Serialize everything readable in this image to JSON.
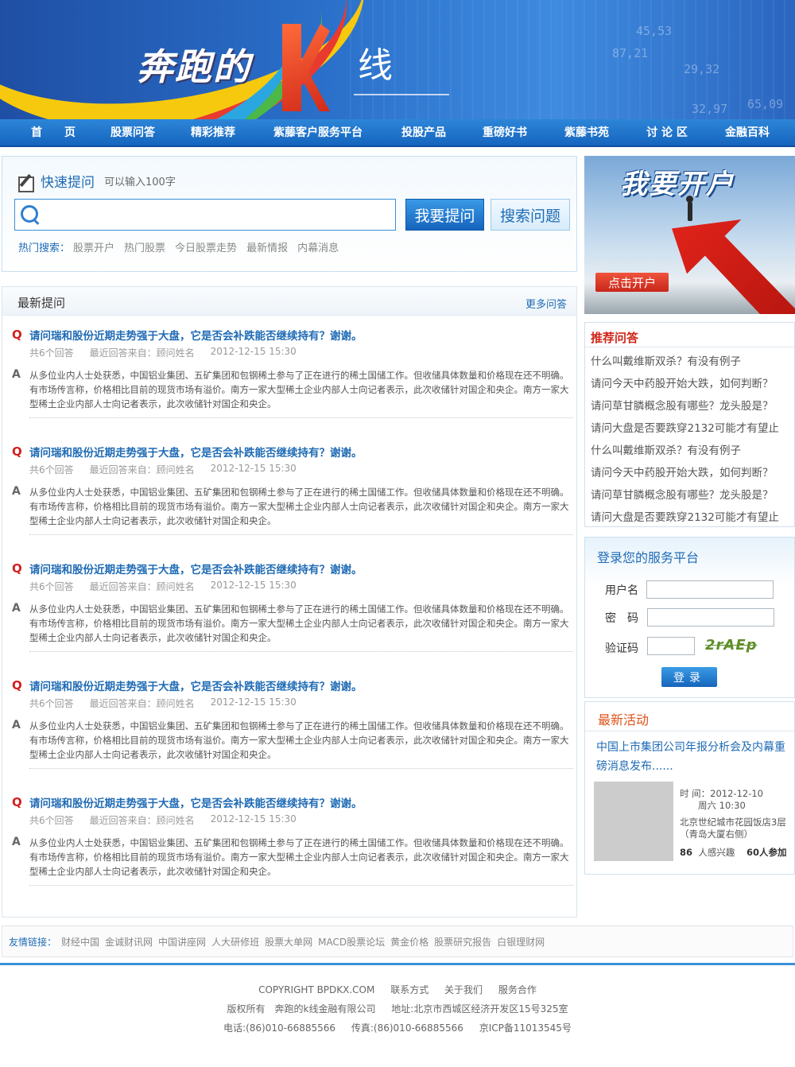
{
  "banner": {
    "title_part1": "奔跑的",
    "title_part2": "线",
    "ticker_numbers": [
      "45,53",
      "87,21",
      "29,32",
      "32,97",
      "65,09"
    ]
  },
  "nav": {
    "items": [
      "首　　页",
      "股票问答",
      "精彩推荐",
      "紫藤客户服务平台",
      "投股产品",
      "重磅好书",
      "紫藤书苑",
      "讨 论 区",
      "金融百科"
    ]
  },
  "ask": {
    "title": "快速提问",
    "hint": "可以输入100字",
    "search_placeholder": "",
    "ask_button": "我要提问",
    "search_button": "搜索问题",
    "hot_label": "热门搜索：",
    "hot_keywords": [
      "股票开户",
      "热门股票",
      "今日股票走势",
      "最新情报",
      "内幕消息"
    ]
  },
  "latest": {
    "title": "最新提问",
    "more": "更多问答",
    "items": [
      {
        "question": "请问瑞和股份近期走势强于大盘，它是否会补跌能否继续持有？谢谢。",
        "count": "共6个回答",
        "from": "最近回答来自：顾问姓名",
        "time": "2012-12-15 15:30",
        "answer": "从多位业内人士处获悉，中国铝业集团、五矿集团和包钢稀土参与了正在进行的稀土国储工作。但收储具体数量和价格现在还不明确。有市场传言称，价格相比目前的现货市场有溢价。南方一家大型稀土企业内部人士向记者表示，此次收储针对国企和央企。南方一家大型稀土企业内部人士向记者表示，此次收储针对国企和央企。"
      },
      {
        "question": "请问瑞和股份近期走势强于大盘，它是否会补跌能否继续持有？谢谢。",
        "count": "共6个回答",
        "from": "最近回答来自：顾问姓名",
        "time": "2012-12-15 15:30",
        "answer": "从多位业内人士处获悉，中国铝业集团、五矿集团和包钢稀土参与了正在进行的稀土国储工作。但收储具体数量和价格现在还不明确。有市场传言称，价格相比目前的现货市场有溢价。南方一家大型稀土企业内部人士向记者表示，此次收储针对国企和央企。南方一家大型稀土企业内部人士向记者表示，此次收储针对国企和央企。"
      },
      {
        "question": "请问瑞和股份近期走势强于大盘，它是否会补跌能否继续持有？谢谢。",
        "count": "共6个回答",
        "from": "最近回答来自：顾问姓名",
        "time": "2012-12-15 15:30",
        "answer": "从多位业内人士处获悉，中国铝业集团、五矿集团和包钢稀土参与了正在进行的稀土国储工作。但收储具体数量和价格现在还不明确。有市场传言称，价格相比目前的现货市场有溢价。南方一家大型稀土企业内部人士向记者表示，此次收储针对国企和央企。南方一家大型稀土企业内部人士向记者表示，此次收储针对国企和央企。"
      },
      {
        "question": "请问瑞和股份近期走势强于大盘，它是否会补跌能否继续持有？谢谢。",
        "count": "共6个回答",
        "from": "最近回答来自：顾问姓名",
        "time": "2012-12-15 15:30",
        "answer": "从多位业内人士处获悉，中国铝业集团、五矿集团和包钢稀土参与了正在进行的稀土国储工作。但收储具体数量和价格现在还不明确。有市场传言称，价格相比目前的现货市场有溢价。南方一家大型稀土企业内部人士向记者表示，此次收储针对国企和央企。南方一家大型稀土企业内部人士向记者表示，此次收储针对国企和央企。"
      },
      {
        "question": "请问瑞和股份近期走势强于大盘，它是否会补跌能否继续持有？谢谢。",
        "count": "共6个回答",
        "from": "最近回答来自：顾问姓名",
        "time": "2012-12-15 15:30",
        "answer": "从多位业内人士处获悉，中国铝业集团、五矿集团和包钢稀土参与了正在进行的稀土国储工作。但收储具体数量和价格现在还不明确。有市场传言称，价格相比目前的现货市场有溢价。南方一家大型稀土企业内部人士向记者表示，此次收储针对国企和央企。南方一家大型稀土企业内部人士向记者表示，此次收储针对国企和央企。"
      }
    ]
  },
  "open_account": {
    "headline": "我要开户",
    "button": "点击开户"
  },
  "recommend": {
    "title": "推荐问答",
    "items": [
      "什么叫戴维斯双杀？有没有例子",
      "请问今天中药股开始大跌，如何判断？",
      "请问草甘膦概念股有哪些？龙头股是？",
      "请问大盘是否要跌穿2132可能才有望止",
      "什么叫戴维斯双杀？有没有例子",
      "请问今天中药股开始大跌，如何判断？",
      "请问草甘膦概念股有哪些？龙头股是？",
      "请问大盘是否要跌穿2132可能才有望止"
    ]
  },
  "login": {
    "title": "登录您的服务平台",
    "username_label": "用户名",
    "password_label": "密　码",
    "captcha_label": "验证码",
    "captcha_text": "2rAEp",
    "button": "登录"
  },
  "activity": {
    "title": "最新活动",
    "headline": "中国上市集团公司年报分析会及内幕重磅消息发布......",
    "time_label": "时 间：",
    "date": "2012-12-10",
    "weekday_time": "周六 10:30",
    "venue": "北京世纪城市花园饭店3层（青岛大厦右侧）",
    "interested_count": "86",
    "interested_label": "人感兴趣",
    "joined": "60人参加"
  },
  "friend_links": {
    "label": "友情链接：",
    "items": [
      "财经中国",
      "金诚财讯网",
      "中国讲座网",
      "人大研修班",
      "股票大单网",
      "MACD股票论坛",
      "黄金价格",
      "股票研究报告",
      "白银理财网"
    ]
  },
  "footer": {
    "copyright": "COPYRIGHT BPDKX.COM",
    "links": [
      "联系方式",
      "关于我们",
      "服务合作"
    ],
    "rights": "版权所有　奔跑的k线金融有限公司",
    "address": "地址:北京市西城区经济开发区15号325室",
    "phone": "电话:(86)010-66885566",
    "fax": "传真:(86)010-66885566",
    "icp": "京ICP备11013545号"
  }
}
